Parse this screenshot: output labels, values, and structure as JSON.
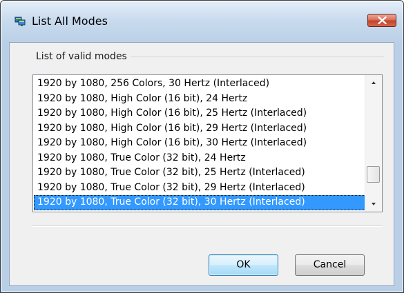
{
  "window": {
    "title": "List All Modes",
    "icons": {
      "app": "monitor-settings-icon",
      "close": "close-icon"
    }
  },
  "group": {
    "label": "List of valid modes"
  },
  "modes": [
    "1920 by 1080, 256 Colors, 30 Hertz (Interlaced)",
    "1920 by 1080, High Color (16 bit), 24 Hertz",
    "1920 by 1080, High Color (16 bit), 25 Hertz (Interlaced)",
    "1920 by 1080, High Color (16 bit), 29 Hertz (Interlaced)",
    "1920 by 1080, High Color (16 bit), 30 Hertz (Interlaced)",
    "1920 by 1080, True Color (32 bit), 24 Hertz",
    "1920 by 1080, True Color (32 bit), 25 Hertz (Interlaced)",
    "1920 by 1080, True Color (32 bit), 29 Hertz (Interlaced)",
    "1920 by 1080, True Color (32 bit), 30 Hertz (Interlaced)"
  ],
  "selected_index": 8,
  "buttons": {
    "ok": "OK",
    "cancel": "Cancel"
  },
  "colors": {
    "selection": "#3399ff",
    "close_button": "#c4412c"
  }
}
